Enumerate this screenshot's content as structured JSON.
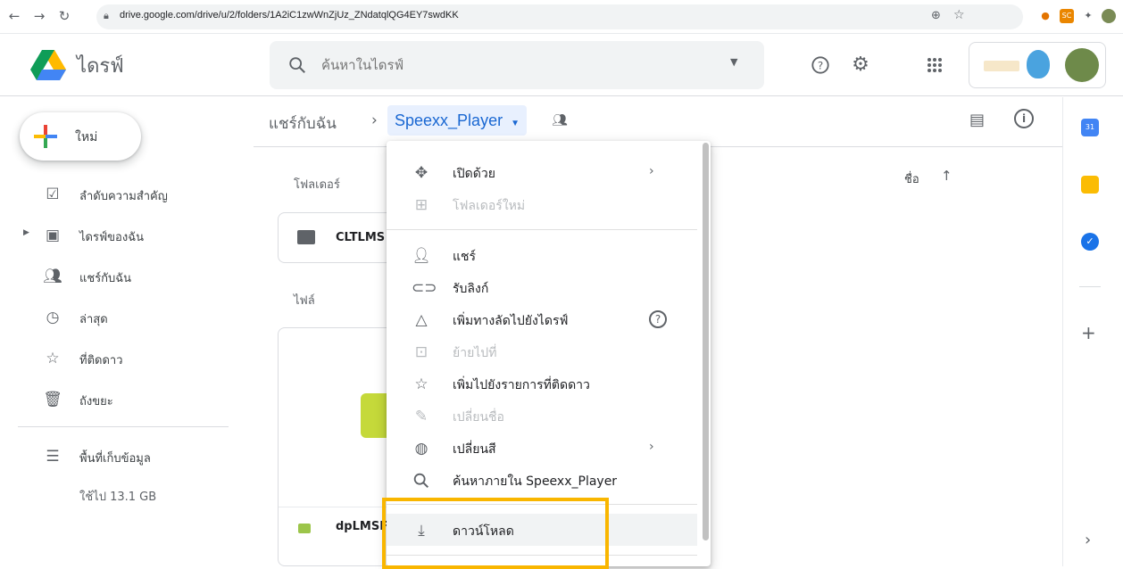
{
  "browser": {
    "url": "drive.google.com/drive/u/2/folders/1A2iC1zwWnZjUz_ZNdatqlQG4EY7swdKK"
  },
  "header": {
    "app_title": "ไดรฟ์",
    "search_placeholder": "ค้นหาในไดรฟ์"
  },
  "sidebar": {
    "new_label": "ใหม่",
    "items": [
      {
        "label": "ลำดับความสำคัญ",
        "icon": "priority-check-icon"
      },
      {
        "label": "ไดรฟ์ของฉัน",
        "icon": "my-drive-icon"
      },
      {
        "label": "แชร์กับฉัน",
        "icon": "shared-people-icon"
      },
      {
        "label": "ล่าสุด",
        "icon": "clock-icon"
      },
      {
        "label": "ที่ติดดาว",
        "icon": "star-icon"
      },
      {
        "label": "ถังขยะ",
        "icon": "trash-icon"
      }
    ],
    "storage_label": "พื้นที่เก็บข้อมูล",
    "storage_used": "ใช้ไป 13.1 GB"
  },
  "breadcrumb": {
    "root": "แชร์กับฉัน",
    "current": "Speexx_Player"
  },
  "main": {
    "folders_label": "โฟลเดอร์",
    "files_label": "ไฟล์",
    "sort_label": "ชื่อ",
    "folder_name": "CLTLMS",
    "file_name": "dpLMSF"
  },
  "context_menu": {
    "items": [
      {
        "label": "เปิดด้วย",
        "icon": "open-with-icon",
        "submenu": true,
        "disabled": false
      },
      {
        "label": "โฟลเดอร์ใหม่",
        "icon": "new-folder-icon",
        "submenu": false,
        "disabled": true
      },
      {
        "label": "แชร์",
        "icon": "share-person-icon",
        "submenu": false,
        "disabled": false
      },
      {
        "label": "รับลิงก์",
        "icon": "link-icon",
        "submenu": false,
        "disabled": false
      },
      {
        "label": "เพิ่มทางลัดไปยังไดรฟ์",
        "icon": "add-shortcut-icon",
        "submenu": false,
        "disabled": false
      },
      {
        "label": "ย้ายไปที่",
        "icon": "move-to-icon",
        "submenu": false,
        "disabled": true
      },
      {
        "label": "เพิ่มไปยังรายการที่ติดดาว",
        "icon": "star-outline-icon",
        "submenu": false,
        "disabled": false
      },
      {
        "label": "เปลี่ยนชื่อ",
        "icon": "rename-pencil-icon",
        "submenu": false,
        "disabled": true
      },
      {
        "label": "เปลี่ยนสี",
        "icon": "palette-icon",
        "submenu": true,
        "disabled": false
      },
      {
        "label": "ค้นหาภายใน Speexx_Player",
        "icon": "search-icon",
        "submenu": false,
        "disabled": false
      },
      {
        "label": "ดาวน์โหลด",
        "icon": "download-icon",
        "submenu": false,
        "disabled": false
      }
    ],
    "submenu_arrow": "›"
  },
  "colors": {
    "accent_blue": "#1967d2",
    "highlight_box": "#f9b600",
    "selected_bg": "#e8f0fe"
  }
}
